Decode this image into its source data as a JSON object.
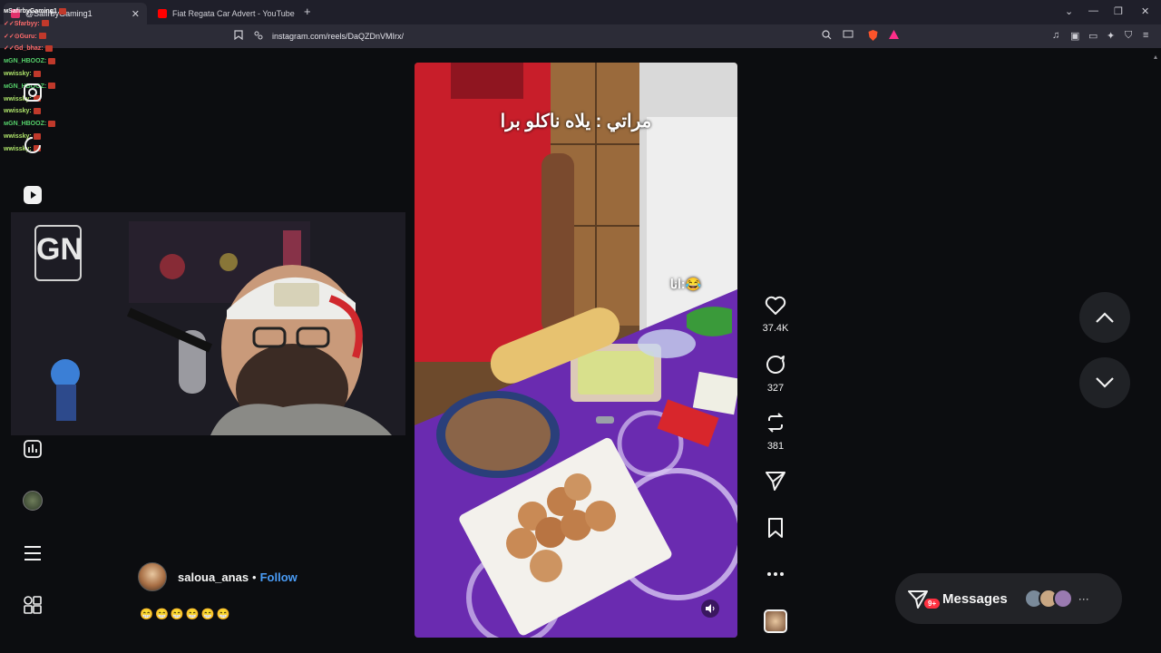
{
  "browser": {
    "tabs": [
      {
        "label": "@SafirbyGaming1",
        "favicon_color": "#e1306c",
        "active": true
      },
      {
        "label": "Fiat Regata Car Advert - YouTube",
        "favicon_color": "#ff0000",
        "active": false
      }
    ],
    "url": "instagram.com/reels/DaQZDnVMIrx/",
    "icons": {
      "new_tab": "+",
      "dropdown": "⌄",
      "minimize": "—",
      "restore": "❐",
      "close": "✕"
    }
  },
  "chat": [
    {
      "user": "ᴍSafirbyGaming1",
      "color": "#ffffff"
    },
    {
      "user": "✓✓Sfarbyy:",
      "color": "#ff6b6b"
    },
    {
      "user": "✓✓⊙Guru:",
      "color": "#ff6b6b"
    },
    {
      "user": "✓✓Gd_bhaz:",
      "color": "#ff6b6b"
    },
    {
      "user": "ᴍGN_HBOOZ:",
      "color": "#55d06a"
    },
    {
      "user": "wwissky:",
      "color": "#aee36a"
    },
    {
      "user": "ᴍGN_HBOOZ:",
      "color": "#55d06a"
    },
    {
      "user": "wwissky:",
      "color": "#aee36a"
    },
    {
      "user": "wwissky:",
      "color": "#aee36a"
    },
    {
      "user": "ᴍGN_HBOOZ:",
      "color": "#55d06a"
    },
    {
      "user": "wwissky:",
      "color": "#aee36a"
    },
    {
      "user": "wwissky:",
      "color": "#aee36a"
    }
  ],
  "webcam": {
    "logo_text": "GN"
  },
  "reel": {
    "caption_top": "مراتي : يلاه ناكلو برا",
    "caption_side": "انا:😂"
  },
  "actions": {
    "likes": "37.4K",
    "comments": "327",
    "reposts": "381"
  },
  "author": {
    "username": "saloua_anas",
    "separator": "•",
    "follow_label": "Follow",
    "caption": "😁😁😁😁😁😁"
  },
  "messages": {
    "label": "Messages",
    "badge": "9+",
    "more": "···"
  },
  "colors": {
    "accent_blue": "#4a9cf6",
    "badge_red": "#ff3040",
    "background": "#0c0d10"
  }
}
